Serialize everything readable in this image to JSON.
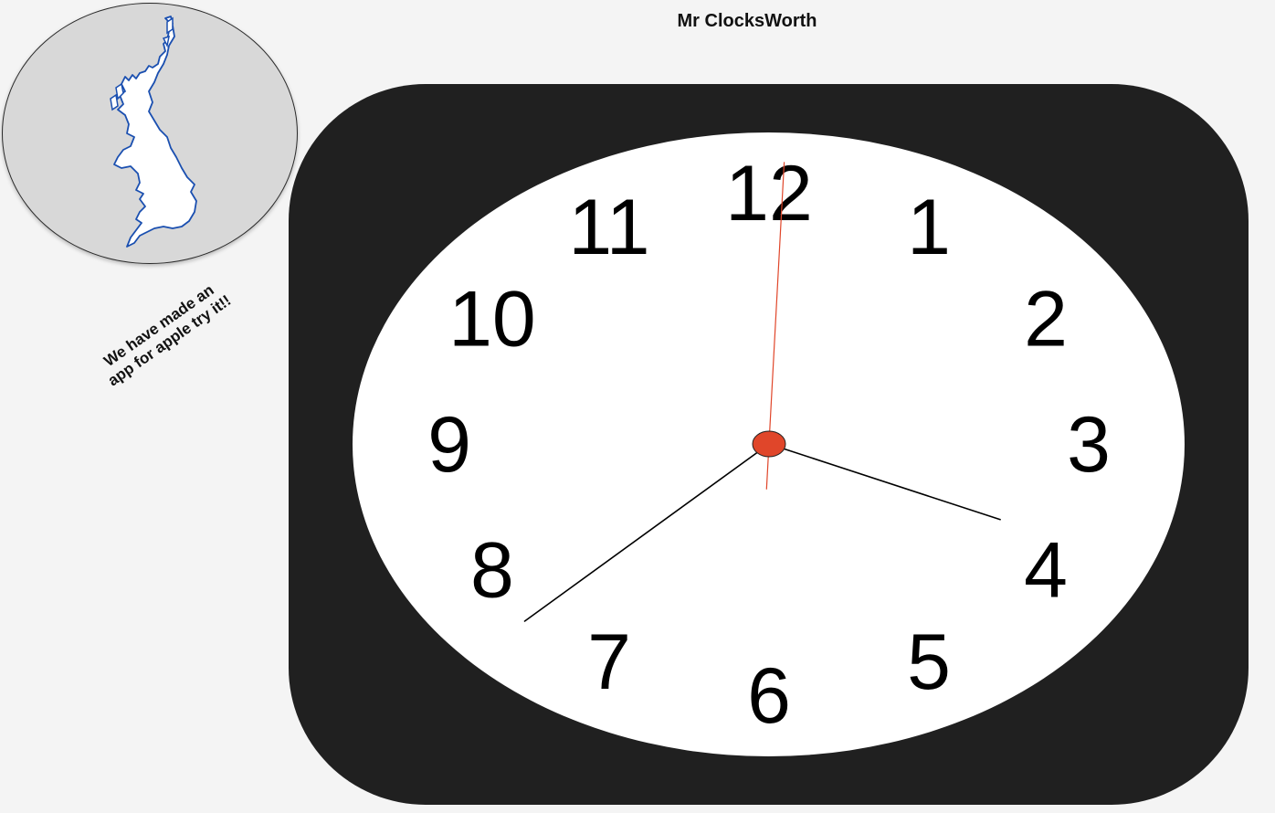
{
  "header": {
    "title": "Mr ClocksWorth"
  },
  "promo": {
    "text": "We have made an app for apple try it!!"
  },
  "map_badge": {
    "icon": "uk-map-icon",
    "fill_color": "#ffffff",
    "outline_color": "#1a4fb0"
  },
  "clock": {
    "numerals": [
      "12",
      "1",
      "2",
      "3",
      "4",
      "5",
      "6",
      "7",
      "8",
      "9",
      "10",
      "11"
    ],
    "time_shown": {
      "hour": 3.5,
      "minute": 38,
      "second": 2
    },
    "colors": {
      "frame": "#202020",
      "face": "#ffffff",
      "second_hand": "#e0462a",
      "center_cap": "#e0462a"
    }
  }
}
